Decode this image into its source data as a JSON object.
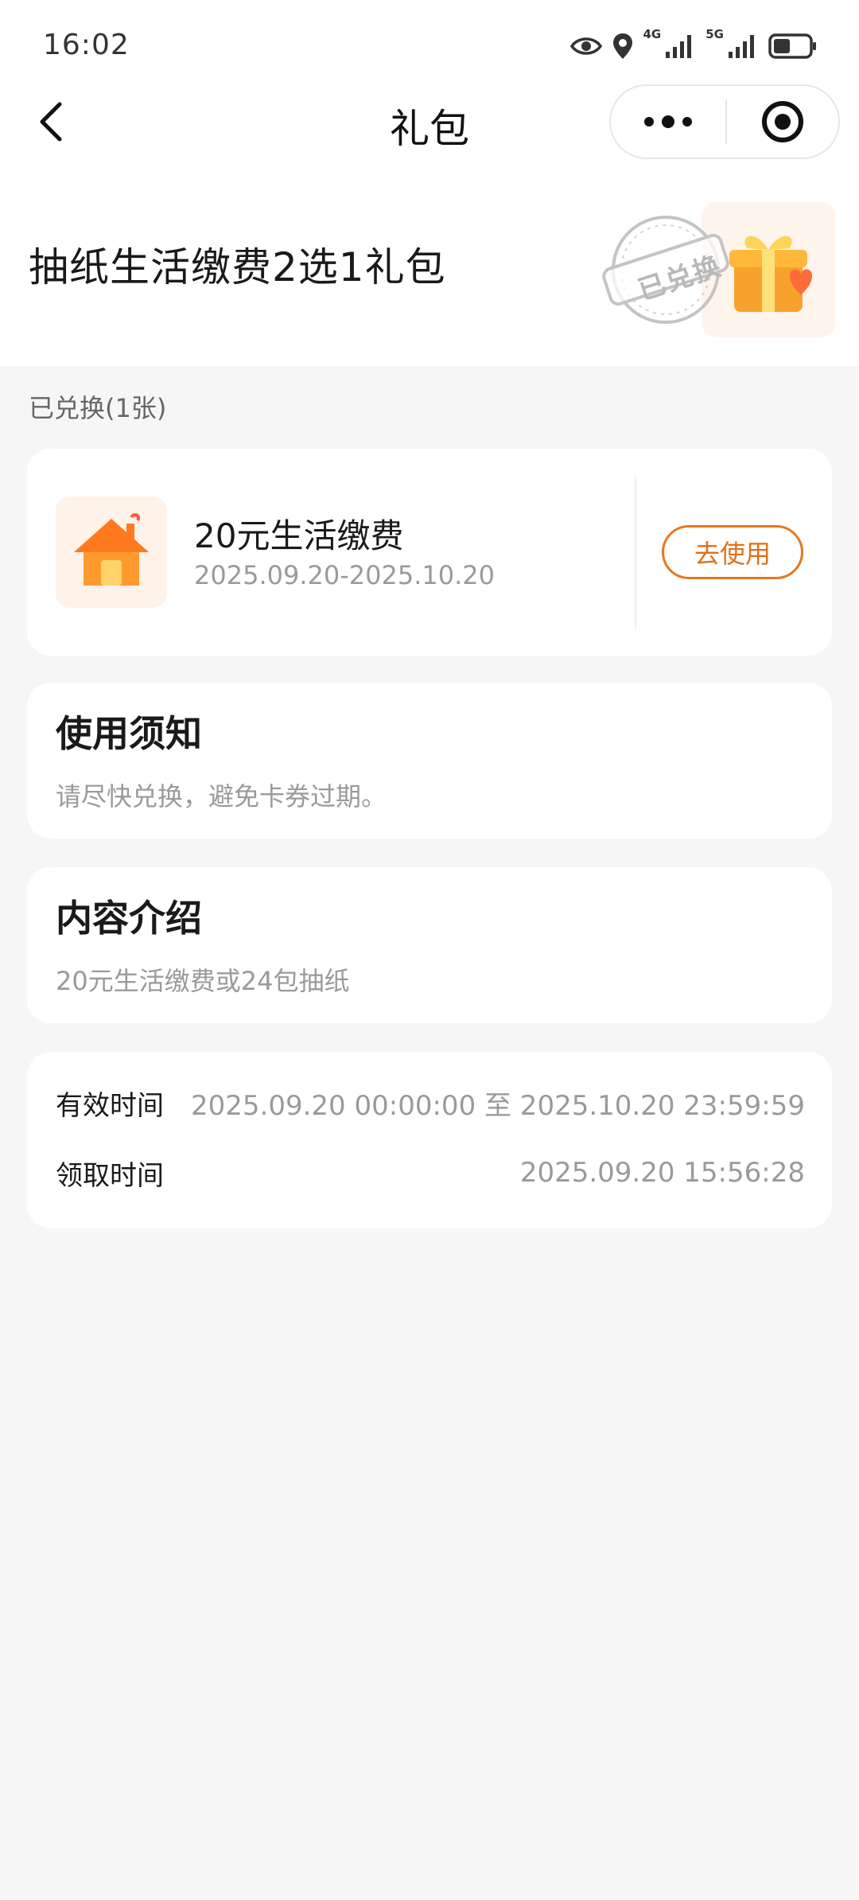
{
  "status_bar": {
    "time": "16:02",
    "net1_label": "4G",
    "net2_label": "5G",
    "icons": [
      "eye-icon",
      "location-icon",
      "signal-icon",
      "signal-icon",
      "battery-icon"
    ]
  },
  "nav": {
    "title": "礼包",
    "icons": [
      "back-arrow-icon",
      "more-dots-icon",
      "target-close-icon"
    ]
  },
  "header": {
    "title": "抽纸生活缴费2选1礼包",
    "stamp_text": "已兑换",
    "icons": [
      "gift-box-icon",
      "redeemed-stamp"
    ]
  },
  "section": {
    "label": "已兑换(1张)"
  },
  "coupon": {
    "name": "20元生活缴费",
    "date_range": "2025.09.20-2025.10.20",
    "button_label": "去使用",
    "icon": "house-icon",
    "accent_color": "#e87722"
  },
  "notice": {
    "title": "使用须知",
    "text": "请尽快兑换，避免卡券过期。"
  },
  "intro": {
    "title": "内容介绍",
    "text": "20元生活缴费或24包抽纸"
  },
  "times": {
    "valid_label": "有效时间",
    "valid_value": "2025.09.20 00:00:00 至 2025.10.20 23:59:59",
    "received_label": "领取时间",
    "received_value": "2025.09.20 15:56:28"
  }
}
